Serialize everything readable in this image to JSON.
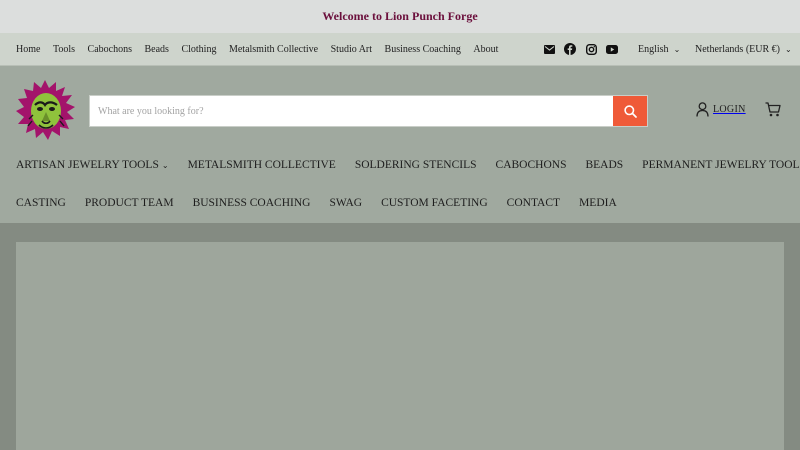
{
  "announcement": "Welcome to Lion Punch Forge",
  "utility_nav": [
    "Home",
    "Tools",
    "Cabochons",
    "Beads",
    "Clothing",
    "Metalsmith Collective",
    "Studio Art",
    "Business Coaching",
    "About"
  ],
  "social_icons": [
    "mail-icon",
    "facebook-icon",
    "instagram-icon",
    "youtube-icon"
  ],
  "language": "English",
  "currency": "Netherlands (EUR €)",
  "search": {
    "placeholder": "What are you looking for?"
  },
  "login_label": "LOGIN",
  "main_nav_row1": [
    {
      "label": "ARTISAN JEWELRY TOOLS",
      "dropdown": true
    },
    {
      "label": "METALSMITH COLLECTIVE"
    },
    {
      "label": "SOLDERING STENCILS"
    },
    {
      "label": "CABOCHONS"
    },
    {
      "label": "BEADS"
    },
    {
      "label": "PERMANENT JEWELRY TOOLS"
    }
  ],
  "main_nav_row2": [
    "CASTING",
    "PRODUCT TEAM",
    "BUSINESS COACHING",
    "SWAG",
    "CUSTOM FACETING",
    "CONTACT",
    "MEDIA"
  ],
  "colors": {
    "accent": "#ef5a38",
    "announcement_text": "#6b0f3c",
    "header_bg": "#a0a99f",
    "logo_magenta": "#a3136b",
    "logo_green": "#8fc23c"
  }
}
